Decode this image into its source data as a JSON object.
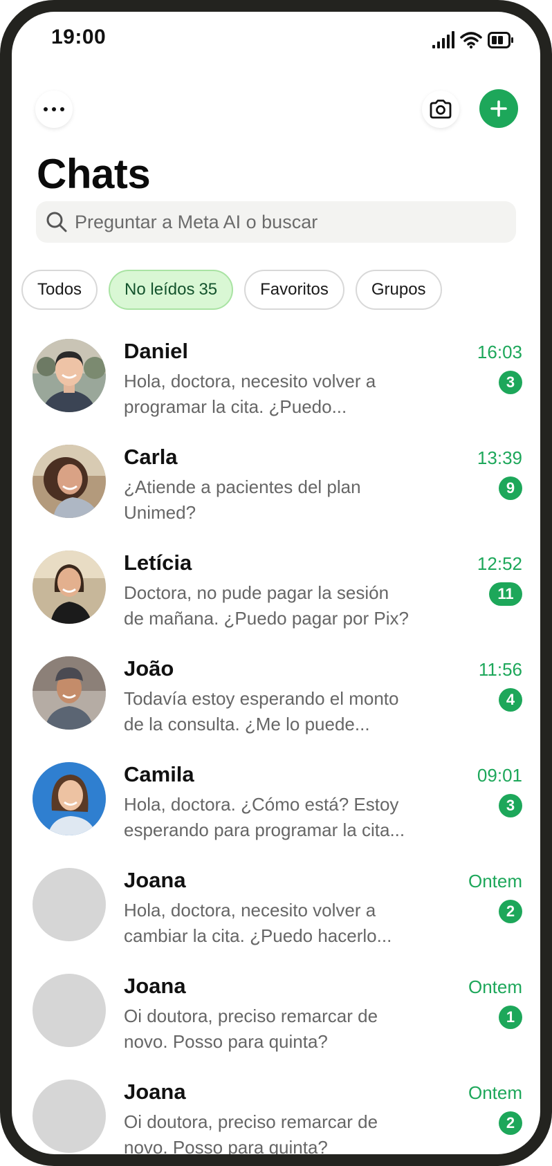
{
  "status_bar": {
    "time": "19:00"
  },
  "header": {
    "title": "Chats"
  },
  "search": {
    "placeholder": "Preguntar a Meta AI o buscar"
  },
  "filters": [
    {
      "label": "Todos",
      "count": "",
      "active": false
    },
    {
      "label": "No leídos",
      "count": "35",
      "active": true
    },
    {
      "label": "Favoritos",
      "count": "",
      "active": false
    },
    {
      "label": "Grupos",
      "count": "",
      "active": false
    }
  ],
  "chats": [
    {
      "name": "Daniel",
      "preview": "Hola, doctora, necesito volver a\nprogramar la cita. ¿Puedo...",
      "time": "16:03",
      "unread": "3",
      "avatar": "photo-man-beard"
    },
    {
      "name": "Carla",
      "preview": "¿Atiende a pacientes del plan\nUnimed?",
      "time": "13:39",
      "unread": "9",
      "avatar": "photo-woman-curly"
    },
    {
      "name": "Letícia",
      "preview": "Doctora, no pude pagar la sesión\nde mañana. ¿Puedo pagar por Pix?",
      "time": "12:52",
      "unread": "11",
      "avatar": "photo-woman-selfie"
    },
    {
      "name": "João",
      "preview": "Todavía estoy esperando el monto\nde la consulta. ¿Me lo puede...",
      "time": "11:56",
      "unread": "4",
      "avatar": "photo-man-cap"
    },
    {
      "name": "Camila",
      "preview": "Hola, doctora. ¿Cómo está? Estoy\nesperando para programar la cita...",
      "time": "09:01",
      "unread": "3",
      "avatar": "photo-woman-blue"
    },
    {
      "name": "Joana",
      "preview": "Hola, doctora, necesito volver a\ncambiar la cita. ¿Puedo hacerlo...",
      "time": "Ontem",
      "unread": "2",
      "avatar": "placeholder"
    },
    {
      "name": "Joana",
      "preview": "Oi doutora, preciso remarcar de\nnovo. Posso para quinta?",
      "time": "Ontem",
      "unread": "1",
      "avatar": "placeholder"
    },
    {
      "name": "Joana",
      "preview": "Oi doutora, preciso remarcar de\nnovo. Posso para quinta?",
      "time": "Ontem",
      "unread": "2",
      "avatar": "placeholder"
    }
  ],
  "colors": {
    "accent": "#1da75a",
    "chip_active_bg": "#d9f7d4",
    "device_frame": "#23231f"
  },
  "icons": {
    "menu": "more-horizontal-icon",
    "camera": "camera-icon",
    "new_chat": "plus-icon",
    "search": "search-icon"
  }
}
